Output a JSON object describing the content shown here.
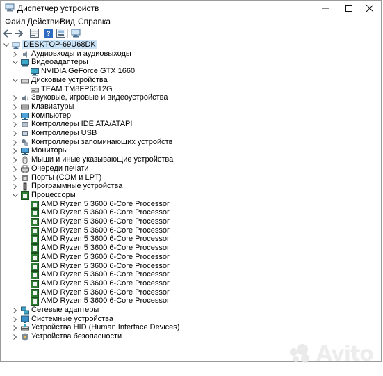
{
  "window": {
    "title": "Диспетчер устройств"
  },
  "menu": [
    "Файл",
    "Действие",
    "Вид",
    "Справка"
  ],
  "toolbar": [
    "back",
    "forward",
    "properties",
    "help",
    "update-driver",
    "scan-hardware"
  ],
  "tree": [
    {
      "level": 0,
      "expander": "expanded",
      "icon": "computer",
      "label": "DESKTOP-69U68DK",
      "selected": true
    },
    {
      "level": 1,
      "expander": "collapsed",
      "icon": "audio",
      "label": "Аудиовходы и аудиовыходы"
    },
    {
      "level": 1,
      "expander": "expanded",
      "icon": "display",
      "label": "Видеоадаптеры"
    },
    {
      "level": 2,
      "expander": "none",
      "icon": "display",
      "label": "NVIDIA GeForce GTX 1660"
    },
    {
      "level": 1,
      "expander": "expanded",
      "icon": "disk",
      "label": "Дисковые устройства"
    },
    {
      "level": 2,
      "expander": "none",
      "icon": "disk",
      "label": "TEAM TM8FP6512G"
    },
    {
      "level": 1,
      "expander": "collapsed",
      "icon": "sound",
      "label": "Звуковые, игровые и видеоустройства"
    },
    {
      "level": 1,
      "expander": "collapsed",
      "icon": "keyboard",
      "label": "Клавиатуры"
    },
    {
      "level": 1,
      "expander": "collapsed",
      "icon": "monitor",
      "label": "Компьютер"
    },
    {
      "level": 1,
      "expander": "collapsed",
      "icon": "ide",
      "label": "Контроллеры IDE ATA/ATAPI"
    },
    {
      "level": 1,
      "expander": "collapsed",
      "icon": "usb",
      "label": "Контроллеры USB"
    },
    {
      "level": 1,
      "expander": "collapsed",
      "icon": "storage",
      "label": "Контроллеры запоминающих устройств"
    },
    {
      "level": 1,
      "expander": "collapsed",
      "icon": "monitor",
      "label": "Мониторы"
    },
    {
      "level": 1,
      "expander": "collapsed",
      "icon": "mouse",
      "label": "Мыши и иные указывающие устройства"
    },
    {
      "level": 1,
      "expander": "collapsed",
      "icon": "printer",
      "label": "Очереди печати"
    },
    {
      "level": 1,
      "expander": "collapsed",
      "icon": "port",
      "label": "Порты (COM и LPT)"
    },
    {
      "level": 1,
      "expander": "collapsed",
      "icon": "software",
      "label": "Программные устройства"
    },
    {
      "level": 1,
      "expander": "expanded",
      "icon": "cpu",
      "label": "Процессоры"
    },
    {
      "level": 2,
      "expander": "none",
      "icon": "cpu",
      "label": "AMD Ryzen 5 3600 6-Core Processor"
    },
    {
      "level": 2,
      "expander": "none",
      "icon": "cpu",
      "label": "AMD Ryzen 5 3600 6-Core Processor"
    },
    {
      "level": 2,
      "expander": "none",
      "icon": "cpu",
      "label": "AMD Ryzen 5 3600 6-Core Processor"
    },
    {
      "level": 2,
      "expander": "none",
      "icon": "cpu",
      "label": "AMD Ryzen 5 3600 6-Core Processor"
    },
    {
      "level": 2,
      "expander": "none",
      "icon": "cpu",
      "label": "AMD Ryzen 5 3600 6-Core Processor"
    },
    {
      "level": 2,
      "expander": "none",
      "icon": "cpu",
      "label": "AMD Ryzen 5 3600 6-Core Processor"
    },
    {
      "level": 2,
      "expander": "none",
      "icon": "cpu",
      "label": "AMD Ryzen 5 3600 6-Core Processor"
    },
    {
      "level": 2,
      "expander": "none",
      "icon": "cpu",
      "label": "AMD Ryzen 5 3600 6-Core Processor"
    },
    {
      "level": 2,
      "expander": "none",
      "icon": "cpu",
      "label": "AMD Ryzen 5 3600 6-Core Processor"
    },
    {
      "level": 2,
      "expander": "none",
      "icon": "cpu",
      "label": "AMD Ryzen 5 3600 6-Core Processor"
    },
    {
      "level": 2,
      "expander": "none",
      "icon": "cpu",
      "label": "AMD Ryzen 5 3600 6-Core Processor"
    },
    {
      "level": 2,
      "expander": "none",
      "icon": "cpu",
      "label": "AMD Ryzen 5 3600 6-Core Processor"
    },
    {
      "level": 1,
      "expander": "collapsed",
      "icon": "network",
      "label": "Сетевые адаптеры"
    },
    {
      "level": 1,
      "expander": "collapsed",
      "icon": "system",
      "label": "Системные устройства"
    },
    {
      "level": 1,
      "expander": "collapsed",
      "icon": "hid",
      "label": "Устройства HID (Human Interface Devices)"
    },
    {
      "level": 1,
      "expander": "collapsed",
      "icon": "security",
      "label": "Устройства безопасности"
    }
  ],
  "watermark": {
    "text": "Avito"
  }
}
